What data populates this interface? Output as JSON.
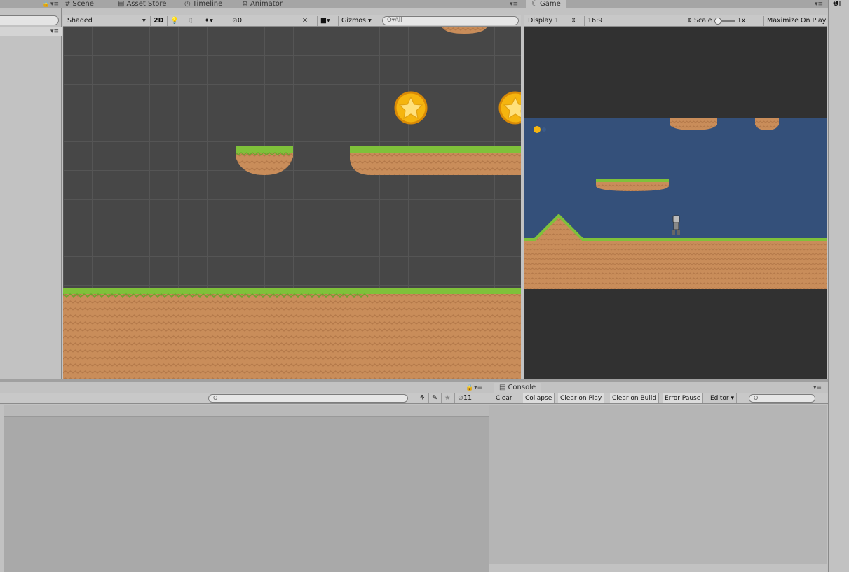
{
  "tabs": {
    "scene": "Scene",
    "asset_store": "Asset Store",
    "timeline": "Timeline",
    "animator": "Animator",
    "game": "Game",
    "inspector_glyph": "I"
  },
  "pane_menu_glyph": "▾≡",
  "lock_glyph": "🔒",
  "scene_toolbar": {
    "shading_mode": "Shaded",
    "mode_2d": "2D",
    "hidden_count": "0",
    "gizmos": "Gizmos",
    "search_placeholder": "Q▾All"
  },
  "game_toolbar": {
    "display": "Display 1",
    "aspect": "16:9",
    "scale_label": "Scale",
    "scale_value": "1x",
    "maximize": "Maximize On Play"
  },
  "project": {
    "search_placeholder": "Q",
    "hidden_count": "11"
  },
  "console": {
    "tab": "Console",
    "buttons": {
      "clear": "Clear",
      "collapse": "Collapse",
      "clear_on_play": "Clear on Play",
      "clear_on_build": "Clear on Build",
      "error_pause": "Error Pause",
      "editor": "Editor"
    },
    "search_placeholder": "Q"
  },
  "colors": {
    "editor_bg": "#c2c2c2",
    "scene_bg": "#474747",
    "game_sky": "#34507a",
    "grass": "#7fc13a",
    "dirt": "#c98d5a",
    "coin": "#f5b50f"
  },
  "icons": {
    "scene": "scene-grid-icon",
    "asset_store": "store-icon",
    "timeline": "timeline-icon",
    "animator": "animator-icon",
    "game": "game-controller-icon",
    "console": "console-icon",
    "lightbulb": "lighting-icon",
    "audio": "audio-icon",
    "effects": "effects-icon",
    "visibility": "visibility-icon",
    "tools": "tools-icon",
    "camera": "camera-icon"
  }
}
